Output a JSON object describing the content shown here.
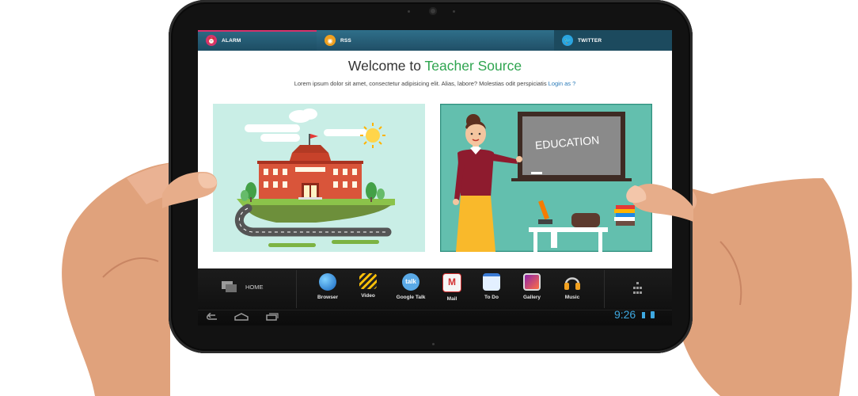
{
  "tabs": [
    {
      "label": "ALARM",
      "icon": "alarm-icon",
      "color": "#d6336c"
    },
    {
      "label": "RSS",
      "icon": "rss-icon",
      "color": "#f0a020"
    },
    {
      "label": "TWITTER",
      "icon": "twitter-icon",
      "color": "#2aa4e0"
    }
  ],
  "header": {
    "title_prefix": "Welcome to ",
    "title_accent": "Teacher Source",
    "subtitle": "Lorem ipsum dolor sit amet, consectetur adipisicing elit. Alias, labore? Molestias odit perspiciatis ",
    "login_link": "Login as ?"
  },
  "illustrations": {
    "school": {
      "label": "school-illustration"
    },
    "teacher": {
      "label": "teacher-illustration",
      "board_text": "EDUCATION"
    }
  },
  "taskbar": {
    "home_label": "HOME",
    "apps": [
      {
        "label": "Browser",
        "icon": "globe-icon"
      },
      {
        "label": "Video",
        "icon": "clapperboard-icon"
      },
      {
        "label": "Google Talk",
        "icon": "talk-icon"
      },
      {
        "label": "Mail",
        "icon": "mail-icon"
      },
      {
        "label": "To Do",
        "icon": "calendar-icon"
      },
      {
        "label": "Gallery",
        "icon": "gallery-icon"
      },
      {
        "label": "Music",
        "icon": "headphones-icon"
      }
    ],
    "clock": "9:26"
  },
  "colors": {
    "accent_green": "#2ea44f",
    "link_blue": "#2a7ab8",
    "clock_blue": "#3ea8e0"
  }
}
